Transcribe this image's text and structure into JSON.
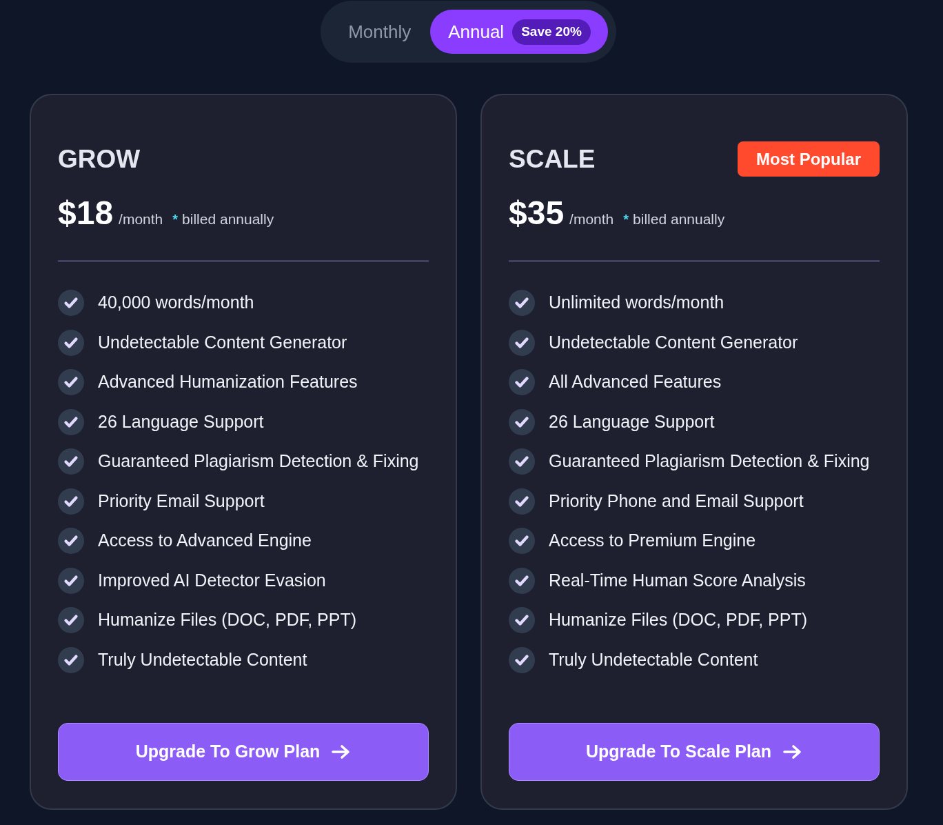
{
  "billing_toggle": {
    "options": [
      {
        "label": "Monthly",
        "selected": false
      },
      {
        "label": "Annual",
        "selected": true,
        "badge": "Save 20%"
      }
    ]
  },
  "plans": [
    {
      "name": "GROW",
      "price": "$18",
      "period": "/month",
      "note_mark": "*",
      "note": "billed annually",
      "features": [
        "40,000 words/month",
        "Undetectable Content Generator",
        "Advanced Humanization Features",
        "26 Language Support",
        "Guaranteed Plagiarism Detection & Fixing",
        "Priority Email Support",
        "Access to Advanced Engine",
        "Improved AI Detector Evasion",
        "Humanize Files (DOC, PDF, PPT)",
        "Truly Undetectable Content"
      ],
      "cta": "Upgrade To Grow Plan"
    },
    {
      "name": "SCALE",
      "badge": "Most Popular",
      "price": "$35",
      "period": "/month",
      "note_mark": "*",
      "note": "billed annually",
      "features": [
        "Unlimited words/month",
        "Undetectable Content Generator",
        "All Advanced Features",
        "26 Language Support",
        "Guaranteed Plagiarism Detection & Fixing",
        "Priority Phone and Email Support",
        "Access to Premium Engine",
        "Real-Time Human Score Analysis",
        "Humanize Files (DOC, PDF, PPT)",
        "Truly Undetectable Content"
      ],
      "cta": "Upgrade To Scale Plan"
    }
  ]
}
